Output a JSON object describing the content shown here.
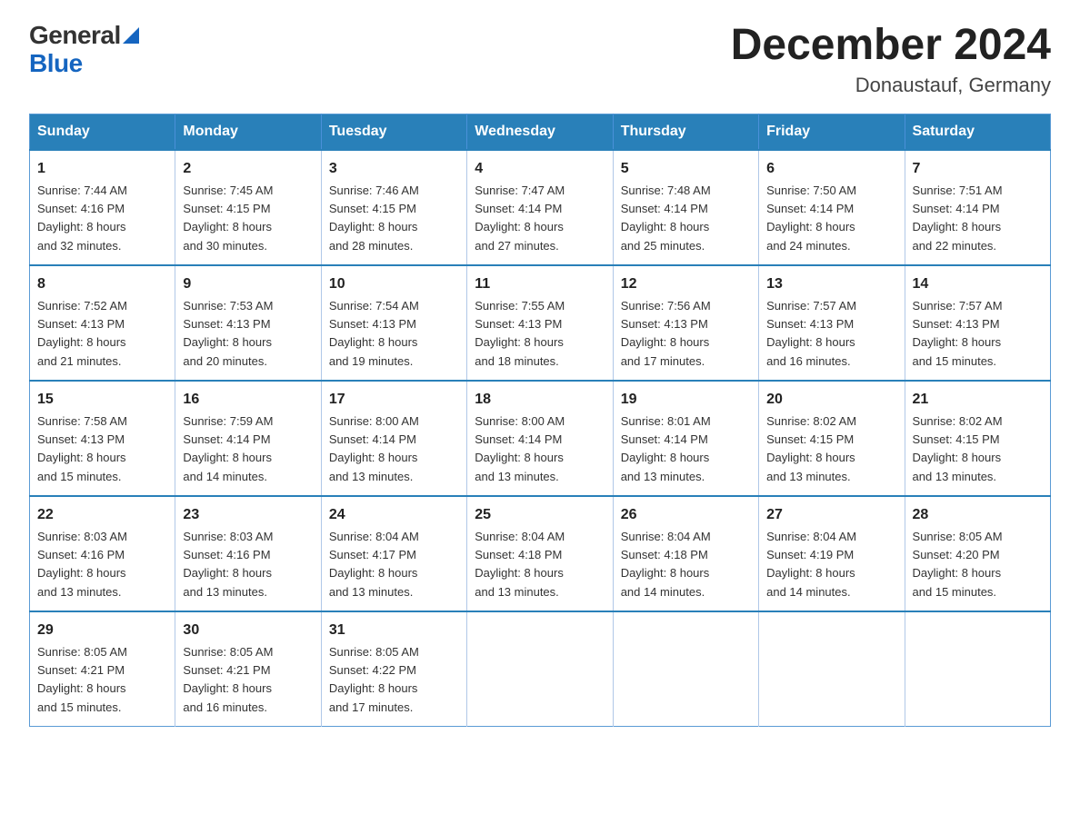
{
  "header": {
    "logo": {
      "general": "General",
      "blue": "Blue"
    },
    "title": "December 2024",
    "subtitle": "Donaustauf, Germany"
  },
  "weekdays": [
    "Sunday",
    "Monday",
    "Tuesday",
    "Wednesday",
    "Thursday",
    "Friday",
    "Saturday"
  ],
  "weeks": [
    [
      {
        "day": "1",
        "sunrise": "7:44 AM",
        "sunset": "4:16 PM",
        "daylight": "8 hours and 32 minutes."
      },
      {
        "day": "2",
        "sunrise": "7:45 AM",
        "sunset": "4:15 PM",
        "daylight": "8 hours and 30 minutes."
      },
      {
        "day": "3",
        "sunrise": "7:46 AM",
        "sunset": "4:15 PM",
        "daylight": "8 hours and 28 minutes."
      },
      {
        "day": "4",
        "sunrise": "7:47 AM",
        "sunset": "4:14 PM",
        "daylight": "8 hours and 27 minutes."
      },
      {
        "day": "5",
        "sunrise": "7:48 AM",
        "sunset": "4:14 PM",
        "daylight": "8 hours and 25 minutes."
      },
      {
        "day": "6",
        "sunrise": "7:50 AM",
        "sunset": "4:14 PM",
        "daylight": "8 hours and 24 minutes."
      },
      {
        "day": "7",
        "sunrise": "7:51 AM",
        "sunset": "4:14 PM",
        "daylight": "8 hours and 22 minutes."
      }
    ],
    [
      {
        "day": "8",
        "sunrise": "7:52 AM",
        "sunset": "4:13 PM",
        "daylight": "8 hours and 21 minutes."
      },
      {
        "day": "9",
        "sunrise": "7:53 AM",
        "sunset": "4:13 PM",
        "daylight": "8 hours and 20 minutes."
      },
      {
        "day": "10",
        "sunrise": "7:54 AM",
        "sunset": "4:13 PM",
        "daylight": "8 hours and 19 minutes."
      },
      {
        "day": "11",
        "sunrise": "7:55 AM",
        "sunset": "4:13 PM",
        "daylight": "8 hours and 18 minutes."
      },
      {
        "day": "12",
        "sunrise": "7:56 AM",
        "sunset": "4:13 PM",
        "daylight": "8 hours and 17 minutes."
      },
      {
        "day": "13",
        "sunrise": "7:57 AM",
        "sunset": "4:13 PM",
        "daylight": "8 hours and 16 minutes."
      },
      {
        "day": "14",
        "sunrise": "7:57 AM",
        "sunset": "4:13 PM",
        "daylight": "8 hours and 15 minutes."
      }
    ],
    [
      {
        "day": "15",
        "sunrise": "7:58 AM",
        "sunset": "4:13 PM",
        "daylight": "8 hours and 15 minutes."
      },
      {
        "day": "16",
        "sunrise": "7:59 AM",
        "sunset": "4:14 PM",
        "daylight": "8 hours and 14 minutes."
      },
      {
        "day": "17",
        "sunrise": "8:00 AM",
        "sunset": "4:14 PM",
        "daylight": "8 hours and 13 minutes."
      },
      {
        "day": "18",
        "sunrise": "8:00 AM",
        "sunset": "4:14 PM",
        "daylight": "8 hours and 13 minutes."
      },
      {
        "day": "19",
        "sunrise": "8:01 AM",
        "sunset": "4:14 PM",
        "daylight": "8 hours and 13 minutes."
      },
      {
        "day": "20",
        "sunrise": "8:02 AM",
        "sunset": "4:15 PM",
        "daylight": "8 hours and 13 minutes."
      },
      {
        "day": "21",
        "sunrise": "8:02 AM",
        "sunset": "4:15 PM",
        "daylight": "8 hours and 13 minutes."
      }
    ],
    [
      {
        "day": "22",
        "sunrise": "8:03 AM",
        "sunset": "4:16 PM",
        "daylight": "8 hours and 13 minutes."
      },
      {
        "day": "23",
        "sunrise": "8:03 AM",
        "sunset": "4:16 PM",
        "daylight": "8 hours and 13 minutes."
      },
      {
        "day": "24",
        "sunrise": "8:04 AM",
        "sunset": "4:17 PM",
        "daylight": "8 hours and 13 minutes."
      },
      {
        "day": "25",
        "sunrise": "8:04 AM",
        "sunset": "4:18 PM",
        "daylight": "8 hours and 13 minutes."
      },
      {
        "day": "26",
        "sunrise": "8:04 AM",
        "sunset": "4:18 PM",
        "daylight": "8 hours and 14 minutes."
      },
      {
        "day": "27",
        "sunrise": "8:04 AM",
        "sunset": "4:19 PM",
        "daylight": "8 hours and 14 minutes."
      },
      {
        "day": "28",
        "sunrise": "8:05 AM",
        "sunset": "4:20 PM",
        "daylight": "8 hours and 15 minutes."
      }
    ],
    [
      {
        "day": "29",
        "sunrise": "8:05 AM",
        "sunset": "4:21 PM",
        "daylight": "8 hours and 15 minutes."
      },
      {
        "day": "30",
        "sunrise": "8:05 AM",
        "sunset": "4:21 PM",
        "daylight": "8 hours and 16 minutes."
      },
      {
        "day": "31",
        "sunrise": "8:05 AM",
        "sunset": "4:22 PM",
        "daylight": "8 hours and 17 minutes."
      },
      null,
      null,
      null,
      null
    ]
  ],
  "labels": {
    "sunrise": "Sunrise:",
    "sunset": "Sunset:",
    "daylight": "Daylight:"
  }
}
